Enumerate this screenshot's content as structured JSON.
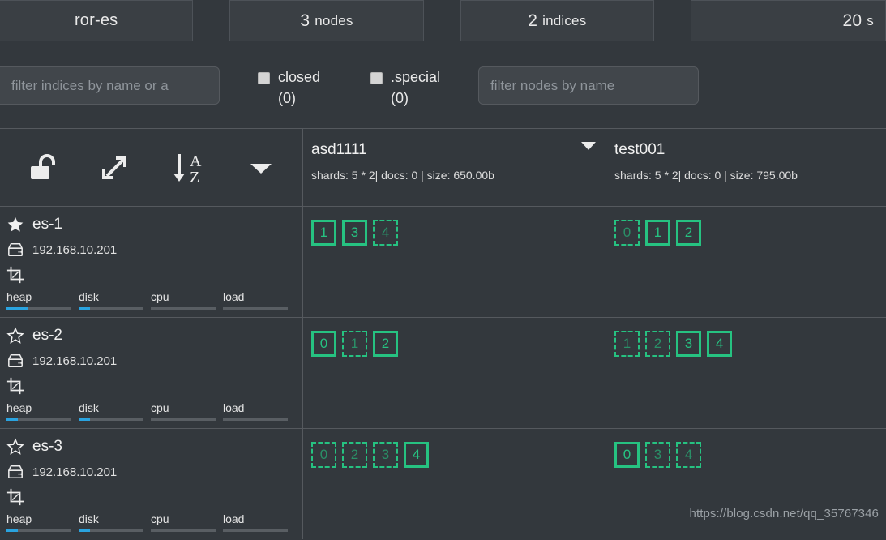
{
  "topbar": {
    "cluster": {
      "label": "ror-es"
    },
    "nodes": {
      "number": "3",
      "unit": "nodes"
    },
    "indices": {
      "number": "2",
      "unit": "indices"
    },
    "refresh": {
      "number": "20",
      "unit": "s"
    }
  },
  "filters": {
    "indices_input": {
      "placeholder": "filter indices by name or a",
      "value": ""
    },
    "nodes_input": {
      "placeholder": "filter nodes by name",
      "value": ""
    },
    "closed": {
      "label": "closed",
      "count": "(0)",
      "checked": false
    },
    "special": {
      "label": ".special",
      "count": "(0)",
      "checked": false
    }
  },
  "toolbar": {
    "lock": {
      "name": "unlock-icon",
      "title": "unlock"
    },
    "expand": {
      "name": "expand-icon",
      "title": "expand"
    },
    "sort": {
      "name": "sort-az-icon",
      "title": "sort a-z"
    },
    "menu": {
      "name": "chevron-down-icon",
      "title": "options"
    }
  },
  "indices": [
    {
      "name": "asd1111",
      "meta": "shards: 5 * 2| docs: 0 | size: 650.00b"
    },
    {
      "name": "test001",
      "meta": "shards: 5 * 2| docs: 0 | size: 795.00b"
    }
  ],
  "gauge_labels": [
    "heap",
    "disk",
    "cpu",
    "load"
  ],
  "nodes": [
    {
      "name": "es-1",
      "ip": "192.168.10.201",
      "master": true,
      "gauges": [
        {
          "label": "heap",
          "percent": 33
        },
        {
          "label": "disk",
          "percent": 18
        },
        {
          "label": "cpu",
          "percent": 0
        },
        {
          "label": "load",
          "percent": 0
        }
      ],
      "shards": {
        "asd1111": [
          {
            "id": "1",
            "type": "primary"
          },
          {
            "id": "3",
            "type": "primary"
          },
          {
            "id": "4",
            "type": "replica"
          }
        ],
        "test001": [
          {
            "id": "0",
            "type": "replica"
          },
          {
            "id": "1",
            "type": "primary"
          },
          {
            "id": "2",
            "type": "primary"
          }
        ]
      }
    },
    {
      "name": "es-2",
      "ip": "192.168.10.201",
      "master": false,
      "gauges": [
        {
          "label": "heap",
          "percent": 18
        },
        {
          "label": "disk",
          "percent": 18
        },
        {
          "label": "cpu",
          "percent": 0
        },
        {
          "label": "load",
          "percent": 0
        }
      ],
      "shards": {
        "asd1111": [
          {
            "id": "0",
            "type": "primary"
          },
          {
            "id": "1",
            "type": "replica"
          },
          {
            "id": "2",
            "type": "primary"
          }
        ],
        "test001": [
          {
            "id": "1",
            "type": "replica"
          },
          {
            "id": "2",
            "type": "replica"
          },
          {
            "id": "3",
            "type": "primary"
          },
          {
            "id": "4",
            "type": "primary"
          }
        ]
      }
    },
    {
      "name": "es-3",
      "ip": "192.168.10.201",
      "master": false,
      "gauges": [
        {
          "label": "heap",
          "percent": 18
        },
        {
          "label": "disk",
          "percent": 18
        },
        {
          "label": "cpu",
          "percent": 0
        },
        {
          "label": "load",
          "percent": 0
        }
      ],
      "shards": {
        "asd1111": [
          {
            "id": "0",
            "type": "replica"
          },
          {
            "id": "2",
            "type": "replica"
          },
          {
            "id": "3",
            "type": "replica"
          },
          {
            "id": "4",
            "type": "primary"
          }
        ],
        "test001": [
          {
            "id": "0",
            "type": "primary"
          },
          {
            "id": "3",
            "type": "replica"
          },
          {
            "id": "4",
            "type": "replica"
          }
        ]
      }
    }
  ],
  "watermark": {
    "text": "https://blog.csdn.net/qq_35767346"
  },
  "colors": {
    "background": "#33383d",
    "panel": "#3a3f44",
    "border": "#55595e",
    "shard_green": "#26c281",
    "gauge_blue": "#2aa3df",
    "text": "#e6e6e6",
    "muted": "#8f959b"
  }
}
